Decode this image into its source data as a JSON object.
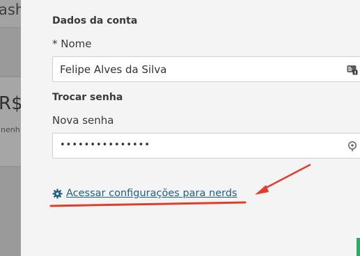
{
  "background": {
    "title_fragment": "ash",
    "currency_fragment": "R$",
    "subtext_fragment": "nenh"
  },
  "form": {
    "account_section": {
      "title": "Dados da conta",
      "name_label": "* Nome",
      "name_value": "Felipe Alves da Silva",
      "name_icon": "contact-card-icon"
    },
    "password_section": {
      "title": "Trocar senha",
      "new_password_label": "Nova senha",
      "new_password_value": "•••••••••••••••",
      "password_icon": "key-icon"
    },
    "nerds_link": {
      "label": "Acessar configurações para nerds",
      "icon": "gear-icon"
    }
  },
  "colors": {
    "link": "#1f5f86",
    "annotation": "#e53b2c",
    "accent_green": "#27ae60"
  }
}
